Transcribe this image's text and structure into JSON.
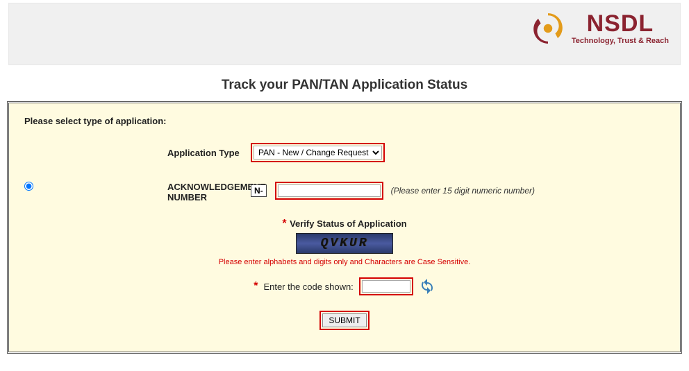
{
  "header": {
    "brand": "NSDL",
    "tagline": "Technology, Trust & Reach"
  },
  "title": "Track your PAN/TAN Application Status",
  "form": {
    "instruction": "Please select type of application:",
    "app_type_label": "Application Type",
    "app_type_value": "PAN - New / Change Request",
    "ack_label": "ACKNOWLEDGEMENT NUMBER",
    "ack_prefix": "N-",
    "ack_hint": "(Please enter 15 digit numeric number)",
    "verify_title": "Verify Status of Application",
    "captcha_text": "QVKUR",
    "captcha_note": "Please enter alphabets and digits only and Characters are Case Sensitive.",
    "code_label": "Enter the code shown:",
    "submit_label": "SUBMIT"
  }
}
